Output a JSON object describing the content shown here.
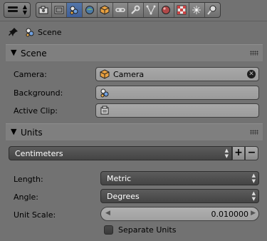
{
  "context": {
    "label": "Scene"
  },
  "tabs": [
    {
      "name": "render",
      "active": false
    },
    {
      "name": "render-layers",
      "active": false
    },
    {
      "name": "scene",
      "active": true
    },
    {
      "name": "world",
      "active": false
    },
    {
      "name": "object",
      "active": false
    },
    {
      "name": "constraints",
      "active": false
    },
    {
      "name": "modifiers",
      "active": false
    },
    {
      "name": "data",
      "active": false
    },
    {
      "name": "material",
      "active": false
    },
    {
      "name": "texture",
      "active": false
    },
    {
      "name": "particles",
      "active": false
    },
    {
      "name": "physics",
      "active": false
    }
  ],
  "scene_panel": {
    "title": "Scene",
    "camera_label": "Camera:",
    "camera_value": "Camera",
    "background_label": "Background:",
    "background_value": "",
    "active_clip_label": "Active Clip:",
    "active_clip_value": ""
  },
  "units_panel": {
    "title": "Units",
    "preset_value": "Centimeters",
    "add_preset_label": "+",
    "remove_preset_label": "−",
    "length_label": "Length:",
    "length_value": "Metric",
    "angle_label": "Angle:",
    "angle_value": "Degrees",
    "unit_scale_label": "Unit Scale:",
    "unit_scale_value": "0.010000",
    "separate_units_label": "Separate Units",
    "separate_units_checked": false
  },
  "colors": {
    "background": "#727272",
    "panel_header": "#7f7f7f",
    "active_tab": "#4a6aa3",
    "dropdown": "#4f4f4f",
    "field": "#a3a3a3"
  }
}
